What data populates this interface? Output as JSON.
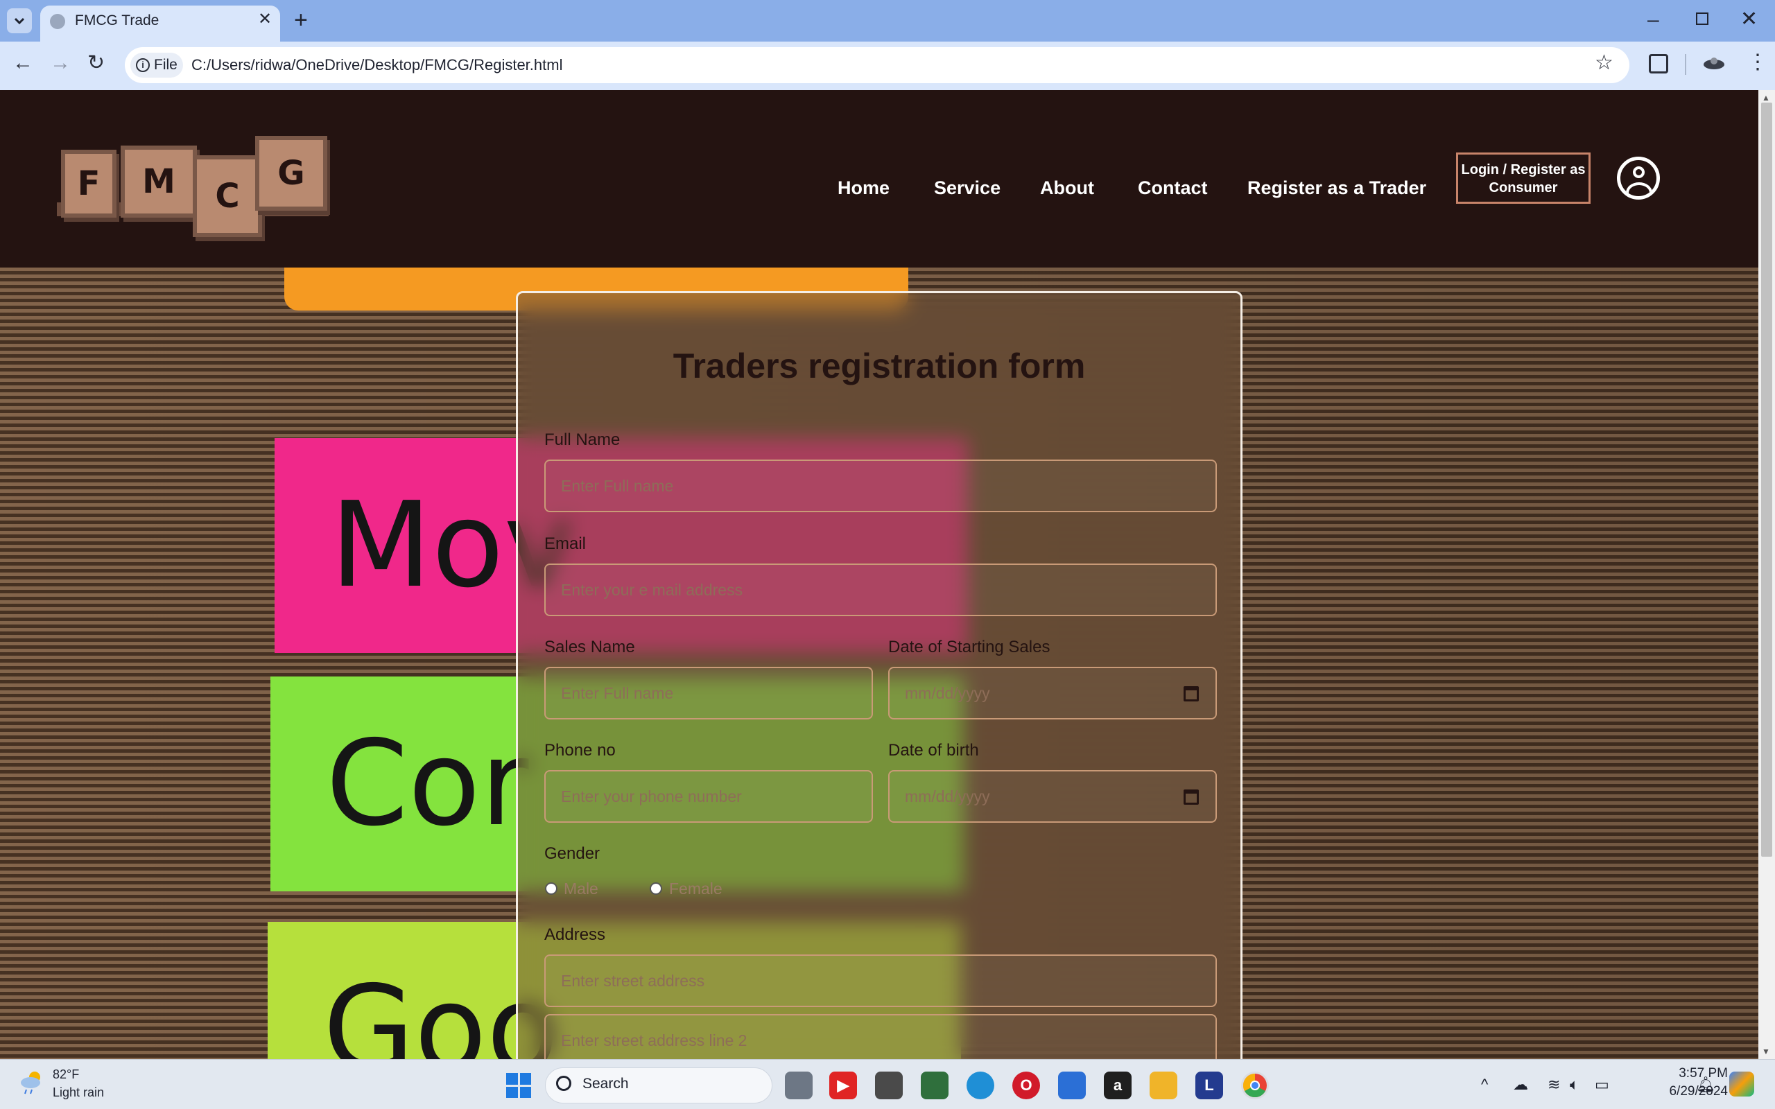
{
  "browser": {
    "tab_title": "FMCG Trade",
    "file_label": "File",
    "url": "C:/Users/ridwa/OneDrive/Desktop/FMCG/Register.html"
  },
  "site": {
    "logo_letters": [
      "F",
      "M",
      "C",
      "G"
    ],
    "nav": [
      "Home",
      "Service",
      "About",
      "Contact",
      "Register as a Trader"
    ],
    "login_button": "Login / Register as Consumer"
  },
  "hero": {
    "notes": [
      "Mov",
      "Cor",
      "Goo"
    ],
    "note_colors": [
      "#f0288a",
      "#84e33e",
      "#b6e03c"
    ]
  },
  "form": {
    "title": "Traders registration form",
    "full_name": {
      "label": "Full Name",
      "placeholder": "Enter Full name"
    },
    "email": {
      "label": "Email",
      "placeholder": "Enter your e mail address"
    },
    "sales_name": {
      "label": "Sales Name",
      "placeholder": "Enter Full name"
    },
    "start_date": {
      "label": "Date of Starting Sales",
      "placeholder": "mm/dd/yyyy"
    },
    "phone": {
      "label": "Phone no",
      "placeholder": "Enter your phone number"
    },
    "dob": {
      "label": "Date of birth",
      "placeholder": "mm/dd/yyyy"
    },
    "gender": {
      "label": "Gender",
      "options": [
        "Male",
        "Female"
      ]
    },
    "address": {
      "label": "Address",
      "line1_placeholder": "Enter street address",
      "line2_placeholder": "Enter street address line 2"
    }
  },
  "taskbar": {
    "weather_temp": "82°F",
    "weather_desc": "Light rain",
    "search_label": "Search",
    "time": "3:57 PM",
    "date": "6/29/2024"
  },
  "colors": {
    "header_bg": "#241311",
    "accent": "#c8846a",
    "form_border": "#f5eee6"
  }
}
